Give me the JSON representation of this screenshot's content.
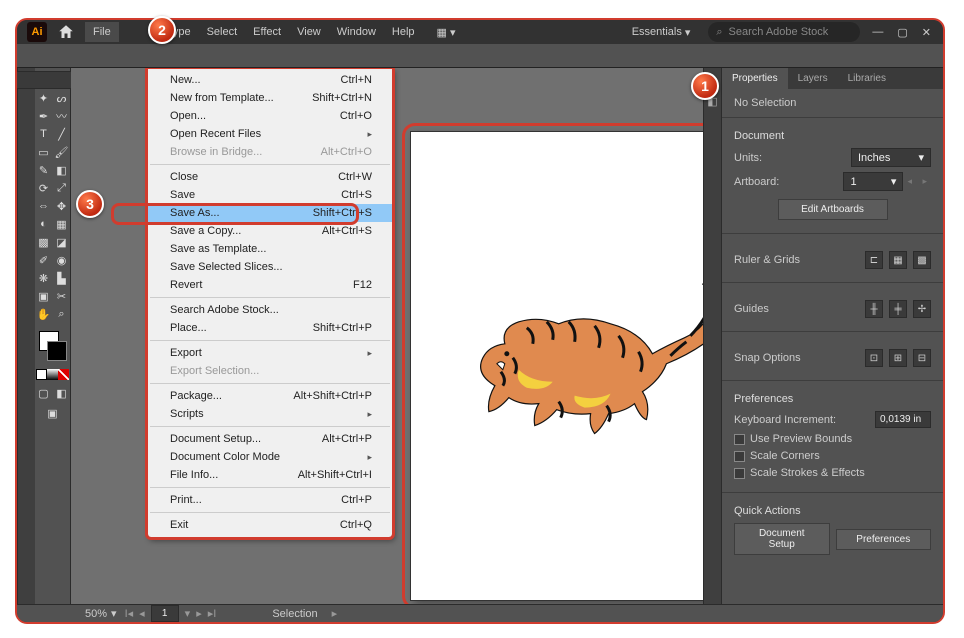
{
  "menubar": {
    "logo": "Ai",
    "items": [
      "File",
      "",
      "",
      "Type",
      "Select",
      "Effect",
      "View",
      "Window",
      "Help"
    ],
    "workspace": "Essentials",
    "search_placeholder": "Search Adobe Stock"
  },
  "file_menu": [
    {
      "label": "New...",
      "shortcut": "Ctrl+N"
    },
    {
      "label": "New from Template...",
      "shortcut": "Shift+Ctrl+N"
    },
    {
      "label": "Open...",
      "shortcut": "Ctrl+O"
    },
    {
      "label": "Open Recent Files",
      "sub": true
    },
    {
      "label": "Browse in Bridge...",
      "shortcut": "Alt+Ctrl+O",
      "disabled": true
    },
    {
      "sep": true
    },
    {
      "label": "Close",
      "shortcut": "Ctrl+W"
    },
    {
      "label": "Save",
      "shortcut": "Ctrl+S"
    },
    {
      "label": "Save As...",
      "shortcut": "Shift+Ctrl+S",
      "highlight": true
    },
    {
      "label": "Save a Copy...",
      "shortcut": "Alt+Ctrl+S"
    },
    {
      "label": "Save as Template..."
    },
    {
      "label": "Save Selected Slices..."
    },
    {
      "label": "Revert",
      "shortcut": "F12"
    },
    {
      "sep": true
    },
    {
      "label": "Search Adobe Stock..."
    },
    {
      "label": "Place...",
      "shortcut": "Shift+Ctrl+P"
    },
    {
      "sep": true
    },
    {
      "label": "Export",
      "sub": true
    },
    {
      "label": "Export Selection...",
      "disabled": true
    },
    {
      "sep": true
    },
    {
      "label": "Package...",
      "shortcut": "Alt+Shift+Ctrl+P"
    },
    {
      "label": "Scripts",
      "sub": true
    },
    {
      "sep": true
    },
    {
      "label": "Document Setup...",
      "shortcut": "Alt+Ctrl+P"
    },
    {
      "label": "Document Color Mode",
      "sub": true
    },
    {
      "label": "File Info...",
      "shortcut": "Alt+Shift+Ctrl+I"
    },
    {
      "sep": true
    },
    {
      "label": "Print...",
      "shortcut": "Ctrl+P"
    },
    {
      "sep": true
    },
    {
      "label": "Exit",
      "shortcut": "Ctrl+Q"
    }
  ],
  "status": {
    "zoom": "50%",
    "page": "1",
    "mode": "Selection"
  },
  "panel": {
    "tabs": [
      "Properties",
      "Layers",
      "Libraries"
    ],
    "selection": "No Selection",
    "document": {
      "title": "Document",
      "units_label": "Units:",
      "units": "Inches",
      "artboard_label": "Artboard:",
      "artboard": "1",
      "edit": "Edit Artboards"
    },
    "ruler": {
      "title": "Ruler & Grids"
    },
    "guides": {
      "title": "Guides"
    },
    "snap": {
      "title": "Snap Options"
    },
    "prefs": {
      "title": "Preferences",
      "kbd_label": "Keyboard Increment:",
      "kbd": "0,0139 in",
      "cb1": "Use Preview Bounds",
      "cb2": "Scale Corners",
      "cb3": "Scale Strokes & Effects"
    },
    "quick": {
      "title": "Quick Actions",
      "b1": "Document Setup",
      "b2": "Preferences"
    }
  },
  "badges": {
    "b1": "1",
    "b2": "2",
    "b3": "3"
  }
}
